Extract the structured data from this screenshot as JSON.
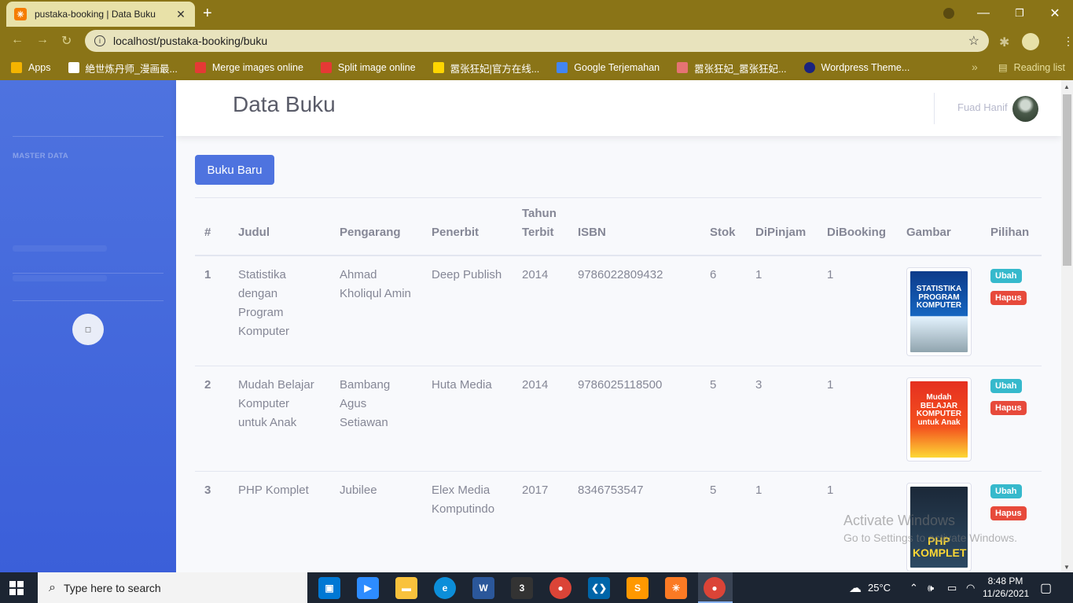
{
  "browser": {
    "tab_title": "pustaka-booking | Data Buku",
    "tab_close": "✕",
    "new_tab": "+",
    "url": "localhost/pustaka-booking/buku",
    "bookmarks": [
      {
        "label": "Apps",
        "color": "#f4b400"
      },
      {
        "label": "絶世炼丹师_漫画最...",
        "color": "#ffffff"
      },
      {
        "label": "Merge images online",
        "color": "#e53935"
      },
      {
        "label": "Split image online",
        "color": "#e53935"
      },
      {
        "label": "嚣张狂妃|官方在线...",
        "color": "#ffd600"
      },
      {
        "label": "Google Terjemahan",
        "color": "#4285f4"
      },
      {
        "label": "嚣张狂妃_嚣张狂妃...",
        "color": "#e57373"
      },
      {
        "label": "Wordpress Theme...",
        "color": "#1a237e"
      }
    ],
    "reading_list": "Reading list"
  },
  "sidebar": {
    "heading": "MASTER DATA",
    "toggle_icon": "chevron-left-icon"
  },
  "topbar": {
    "title": "Data Buku",
    "user_name": "Fuad Hanif"
  },
  "main": {
    "new_button": "Buku Baru",
    "columns": [
      "#",
      "Judul",
      "Pengarang",
      "Penerbit",
      "Tahun Terbit",
      "ISBN",
      "Stok",
      "DiPinjam",
      "DiBooking",
      "Gambar",
      "Pilihan"
    ],
    "edit_label": "Ubah",
    "delete_label": "Hapus",
    "rows": [
      {
        "no": "1",
        "judul": "Statistika dengan Program Komputer",
        "pengarang": "Ahmad Kholiqul Amin",
        "penerbit": "Deep Publish",
        "tahun": "2014",
        "isbn": "9786022809432",
        "stok": "6",
        "dipinjam": "1",
        "dibooking": "1",
        "cover_text": "STATISTIKA PROGRAM KOMPUTER",
        "cover_color": "#0d3b8a"
      },
      {
        "no": "2",
        "judul": "Mudah Belajar Komputer untuk Anak",
        "pengarang": "Bambang Agus Setiawan",
        "penerbit": "Huta Media",
        "tahun": "2014",
        "isbn": "9786025118500",
        "stok": "5",
        "dipinjam": "3",
        "dibooking": "1",
        "cover_text": "Mudah BELAJAR KOMPUTER untuk Anak",
        "cover_color": "#e53020"
      },
      {
        "no": "3",
        "judul": "PHP Komplet",
        "pengarang": "Jubilee",
        "penerbit": "Elex Media Komputindo",
        "tahun": "2017",
        "isbn": "8346753547",
        "stok": "5",
        "dipinjam": "1",
        "dibooking": "1",
        "cover_text": "PHP KOMPLET",
        "cover_color": "#243447"
      }
    ]
  },
  "watermark": {
    "line1": "Activate Windows",
    "line2": "Go to Settings to activate Windows."
  },
  "taskbar": {
    "search_placeholder": "Type here to search",
    "weather": "25°C",
    "time": "8:48 PM",
    "date": "11/26/2021"
  }
}
